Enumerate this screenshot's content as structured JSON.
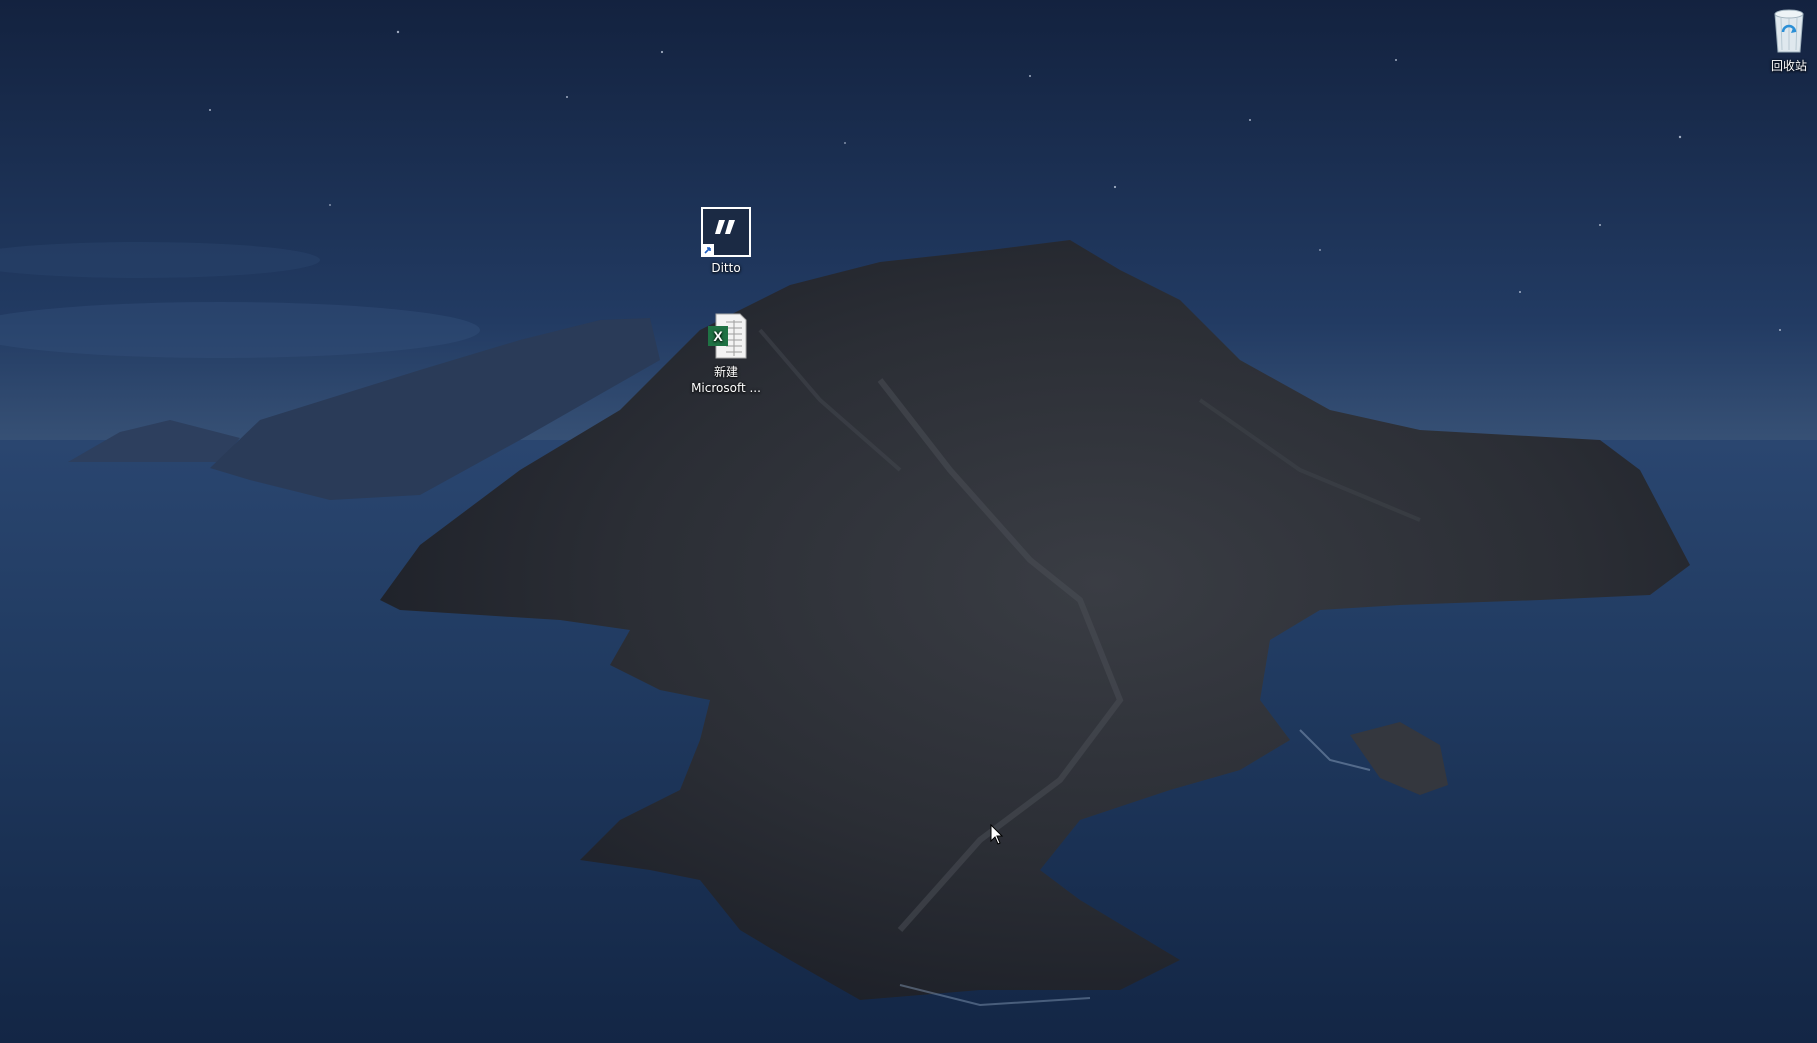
{
  "desktop": {
    "icons": [
      {
        "label": "Ditto",
        "icon": "ditto-app-icon"
      },
      {
        "label_line1": "新建",
        "label_line2": "Microsoft ...",
        "icon": "excel-file-icon"
      },
      {
        "label": "回收站",
        "icon": "recycle-bin-icon"
      }
    ]
  },
  "colors": {
    "sky": "#1b3158",
    "sea": "#1e3457",
    "island": "#2c3036",
    "excel_green": "#1f7244"
  }
}
